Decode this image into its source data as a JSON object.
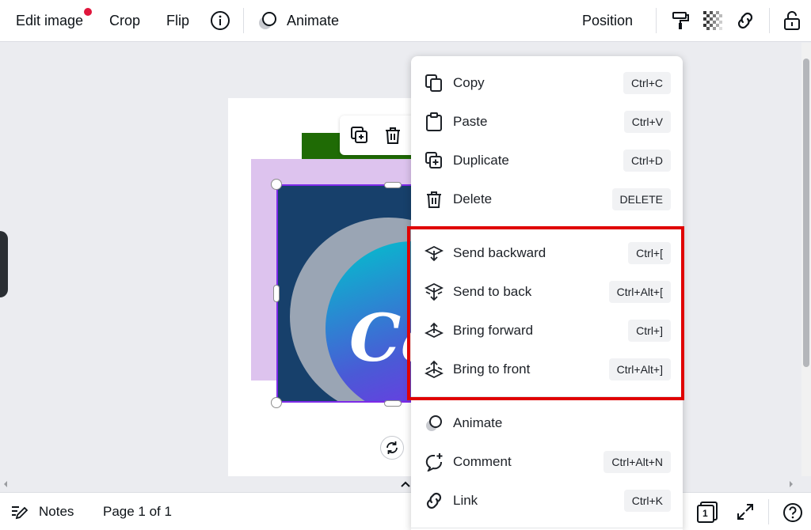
{
  "toolbar": {
    "edit_image": "Edit image",
    "crop": "Crop",
    "flip": "Flip",
    "animate": "Animate",
    "position": "Position",
    "icons": [
      "info-icon",
      "animate-icon",
      "paint-roller-icon",
      "transparency-icon",
      "link-icon",
      "lock-icon"
    ],
    "notification_color": "#e0163c"
  },
  "canvas": {
    "logo_text": "Ca",
    "colors": {
      "green_block": "#1f6b05",
      "lilac_block": "#ddc3ee",
      "selection": "#7d2ae8"
    }
  },
  "context_menu": {
    "items": [
      {
        "label": "Copy",
        "shortcut": "Ctrl+C",
        "icon": "copy-icon"
      },
      {
        "label": "Paste",
        "shortcut": "Ctrl+V",
        "icon": "paste-icon"
      },
      {
        "label": "Duplicate",
        "shortcut": "Ctrl+D",
        "icon": "duplicate-icon"
      },
      {
        "label": "Delete",
        "shortcut": "DELETE",
        "icon": "trash-icon"
      },
      {
        "label": "Send backward",
        "shortcut": "Ctrl+[",
        "icon": "send-backward-icon"
      },
      {
        "label": "Send to back",
        "shortcut": "Ctrl+Alt+[",
        "icon": "send-to-back-icon"
      },
      {
        "label": "Bring forward",
        "shortcut": "Ctrl+]",
        "icon": "bring-forward-icon"
      },
      {
        "label": "Bring to front",
        "shortcut": "Ctrl+Alt+]",
        "icon": "bring-to-front-icon"
      },
      {
        "label": "Animate",
        "shortcut": "",
        "icon": "animate-icon"
      },
      {
        "label": "Comment",
        "shortcut": "Ctrl+Alt+N",
        "icon": "comment-icon"
      },
      {
        "label": "Link",
        "shortcut": "Ctrl+K",
        "icon": "link-icon"
      }
    ],
    "highlight_color": "#e00000"
  },
  "bottombar": {
    "notes": "Notes",
    "page_indicator": "Page 1 of 1",
    "page_count_badge": "1"
  }
}
